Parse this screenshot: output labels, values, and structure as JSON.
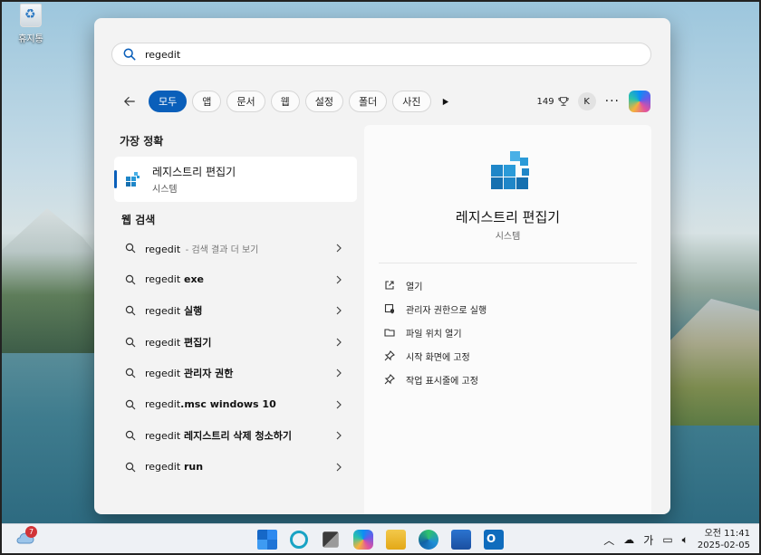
{
  "desktop": {
    "recycle_bin_label": "휴지통"
  },
  "search": {
    "query": "regedit"
  },
  "filters": {
    "chips": [
      {
        "label": "모두",
        "active": true
      },
      {
        "label": "앱",
        "active": false
      },
      {
        "label": "문서",
        "active": false
      },
      {
        "label": "웹",
        "active": false
      },
      {
        "label": "설정",
        "active": false
      },
      {
        "label": "폴더",
        "active": false
      },
      {
        "label": "사진",
        "active": false
      }
    ],
    "points": "149",
    "avatar_initial": "K",
    "more_label": "···"
  },
  "best_match": {
    "section_title": "가장 정확",
    "title": "레지스트리 편집기",
    "subtitle": "시스템"
  },
  "web_search": {
    "section_title": "웹 검색",
    "items": [
      {
        "prefix": "regedit",
        "bold": "",
        "sub": "- 검색 결과 더 보기"
      },
      {
        "prefix": "regedit",
        "bold": " exe",
        "sub": ""
      },
      {
        "prefix": "regedit",
        "bold": " 실행",
        "sub": ""
      },
      {
        "prefix": "regedit",
        "bold": " 편집기",
        "sub": ""
      },
      {
        "prefix": "regedit",
        "bold": " 관리자 권한",
        "sub": ""
      },
      {
        "prefix": "regedit",
        "bold": ".msc windows 10",
        "sub": ""
      },
      {
        "prefix": "regedit",
        "bold": " 레지스트리 삭제 청소하기",
        "sub": ""
      },
      {
        "prefix": "regedit",
        "bold": " run",
        "sub": ""
      }
    ]
  },
  "detail": {
    "name": "레지스트리 편집기",
    "type": "시스템",
    "actions": [
      {
        "label": "열기",
        "icon": "open-icon"
      },
      {
        "label": "관리자 권한으로 실행",
        "icon": "admin-shield-icon"
      },
      {
        "label": "파일 위치 열기",
        "icon": "folder-icon"
      },
      {
        "label": "시작 화면에 고정",
        "icon": "pin-icon"
      },
      {
        "label": "작업 표시줄에 고정",
        "icon": "pin-icon"
      }
    ]
  },
  "taskbar": {
    "weather_badge": "7",
    "tray_lang": "가",
    "clock_time": "오전 11:41",
    "clock_date": "2025-02-05"
  },
  "colors": {
    "accent": "#0a5fba"
  }
}
